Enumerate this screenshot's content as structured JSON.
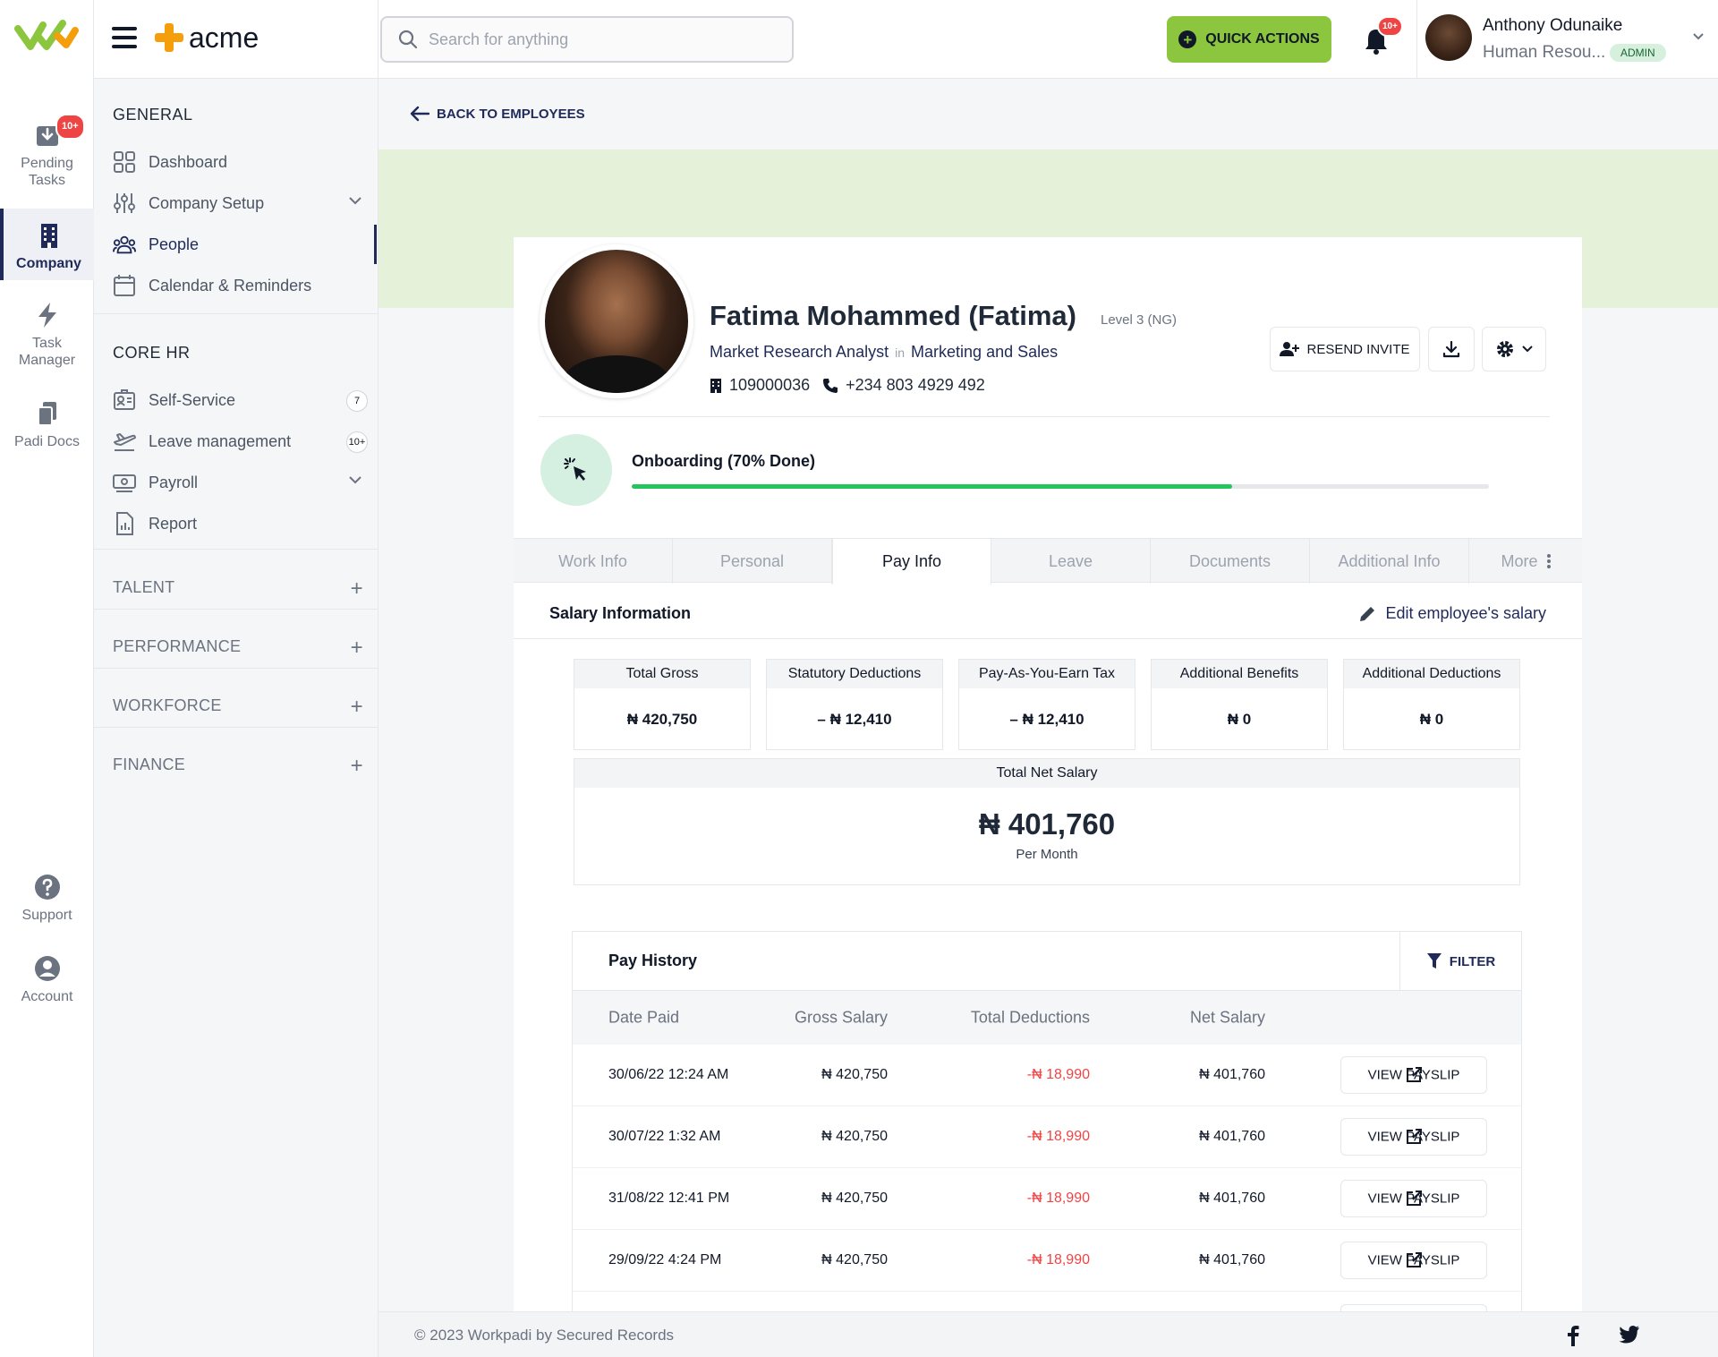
{
  "rail": {
    "items": [
      {
        "label_1": "Pending",
        "label_2": "Tasks",
        "badge": "10+",
        "icon": "inbox-download-icon"
      },
      {
        "label_1": "Company",
        "label_2": "",
        "icon": "building-icon",
        "active": true
      },
      {
        "label_1": "Task",
        "label_2": "Manager",
        "icon": "lightning-icon"
      },
      {
        "label_1": "Padi Docs",
        "label_2": "",
        "icon": "documents-icon"
      },
      {
        "label_1": "Support",
        "label_2": "",
        "icon": "question-icon"
      },
      {
        "label_1": "Account",
        "label_2": "",
        "icon": "user-circle-icon"
      }
    ]
  },
  "topbar": {
    "brand": "acme",
    "search_placeholder": "Search for anything",
    "quick_actions": "QUICK ACTIONS",
    "notifications_badge": "10+",
    "user_name": "Anthony Odunaike",
    "user_role": "Human Resou...",
    "user_badge": "ADMIN"
  },
  "sidebar": {
    "general_title": "GENERAL",
    "general": [
      {
        "label": "Dashboard"
      },
      {
        "label": "Company Setup"
      },
      {
        "label": "People"
      },
      {
        "label": "Calendar & Reminders"
      }
    ],
    "core_title": "CORE HR",
    "core": [
      {
        "label": "Self-Service",
        "count": "7"
      },
      {
        "label": "Leave management",
        "count": "10+"
      },
      {
        "label": "Payroll"
      },
      {
        "label": "Report"
      }
    ],
    "groups": [
      "TALENT",
      "PERFORMANCE",
      "WORKFORCE",
      "FINANCE"
    ]
  },
  "main": {
    "back_label": "BACK TO EMPLOYEES",
    "profile": {
      "name": "Fatima Mohammed (Fatima)",
      "level": "Level 3 (NG)",
      "job_title": "Market Research Analyst",
      "in_word": "in",
      "department": "Marketing and Sales",
      "employee_id": "109000036",
      "phone": "+234 803 4929 492",
      "resend_invite": "RESEND INVITE"
    },
    "onboarding": {
      "label": "Onboarding (70% Done)",
      "progress": 0.7
    },
    "tabs": [
      "Work Info",
      "Personal",
      "Pay Info",
      "Leave",
      "Documents",
      "Additional Info",
      "More"
    ],
    "active_tab": "Pay Info",
    "salary": {
      "title": "Salary Information",
      "edit_label": "Edit employee's salary",
      "stats": [
        {
          "label": "Total Gross",
          "value": "₦ 420,750"
        },
        {
          "label": "Statutory Deductions",
          "value": "– ₦ 12,410"
        },
        {
          "label": "Pay-As-You-Earn Tax",
          "value": "– ₦ 12,410"
        },
        {
          "label": "Additional Benefits",
          "value": "₦ 0"
        },
        {
          "label": "Additional Deductions",
          "value": "₦ 0"
        }
      ],
      "net_label": "Total Net Salary",
      "net_value": "₦ 401,760",
      "net_period": "Per Month"
    },
    "pay_history": {
      "title": "Pay History",
      "filter": "FILTER",
      "columns": [
        "Date Paid",
        "Gross Salary",
        "Total Deductions",
        "Net Salary"
      ],
      "view_label": "VIEW PAYSLIP",
      "rows": [
        {
          "date": "30/06/22 12:24 AM",
          "gross": "₦ 420,750",
          "deductions": "-₦ 18,990",
          "net": "₦ 401,760"
        },
        {
          "date": "30/07/22 1:32 AM",
          "gross": "₦ 420,750",
          "deductions": "-₦ 18,990",
          "net": "₦ 401,760"
        },
        {
          "date": "31/08/22 12:41 PM",
          "gross": "₦ 420,750",
          "deductions": "-₦ 18,990",
          "net": "₦ 401,760"
        },
        {
          "date": "29/09/22 4:24 PM",
          "gross": "₦ 420,750",
          "deductions": "-₦ 18,990",
          "net": "₦ 401,760"
        }
      ]
    }
  },
  "footer": {
    "copyright": "© 2023 Workpadi by Secured Records"
  },
  "colors": {
    "brand_green": "#8cc63f",
    "navy": "#1f2a5a",
    "progress": "#22c55e",
    "negative": "#ef4444",
    "banner": "#e5f2d9"
  }
}
